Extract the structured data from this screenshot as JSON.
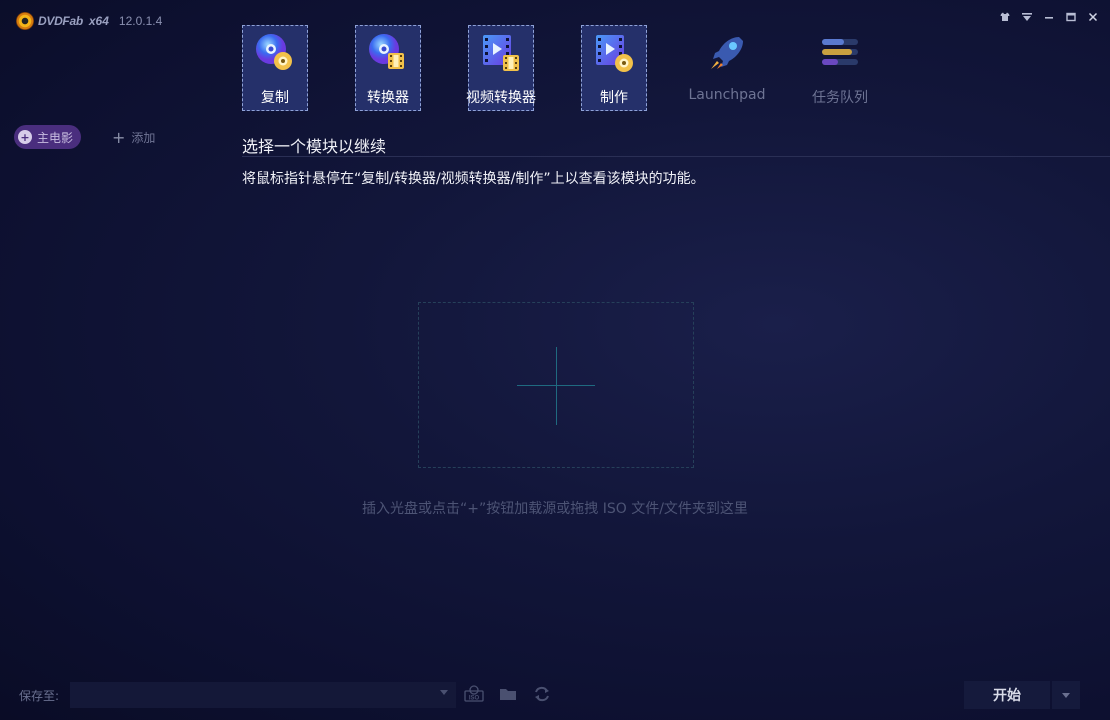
{
  "app": {
    "logo_text": "DVDFab",
    "arch": "x64",
    "version": "12.0.1.4"
  },
  "sidebar": {
    "main_movie_label": "主电影",
    "add_label": "添加"
  },
  "modules": [
    {
      "label": "复制",
      "icon": "disc-copy-icon",
      "selected": true
    },
    {
      "label": "转换器",
      "icon": "disc-converter-icon",
      "selected": true
    },
    {
      "label": "视频转换器",
      "icon": "video-converter-icon",
      "selected": true
    },
    {
      "label": "制作",
      "icon": "video-creator-icon",
      "selected": true
    },
    {
      "label": "Launchpad",
      "icon": "rocket-icon",
      "selected": false
    },
    {
      "label": "任务队列",
      "icon": "task-queue-icon",
      "selected": false
    }
  ],
  "main": {
    "heading": "选择一个模块以继续",
    "subtext": "将鼠标指针悬停在“复制/转换器/视频转换器/制作”上以查看该模块的功能。",
    "drop_hint": "插入光盘或点击“+”按钮加载源或拖拽 ISO 文件/文件夹到这里"
  },
  "bottom": {
    "save_label": "保存至:",
    "save_value": "",
    "start_label": "开始"
  },
  "colors": {
    "accent": "#4a2e7e",
    "selected_module_bg": "#25306a"
  }
}
